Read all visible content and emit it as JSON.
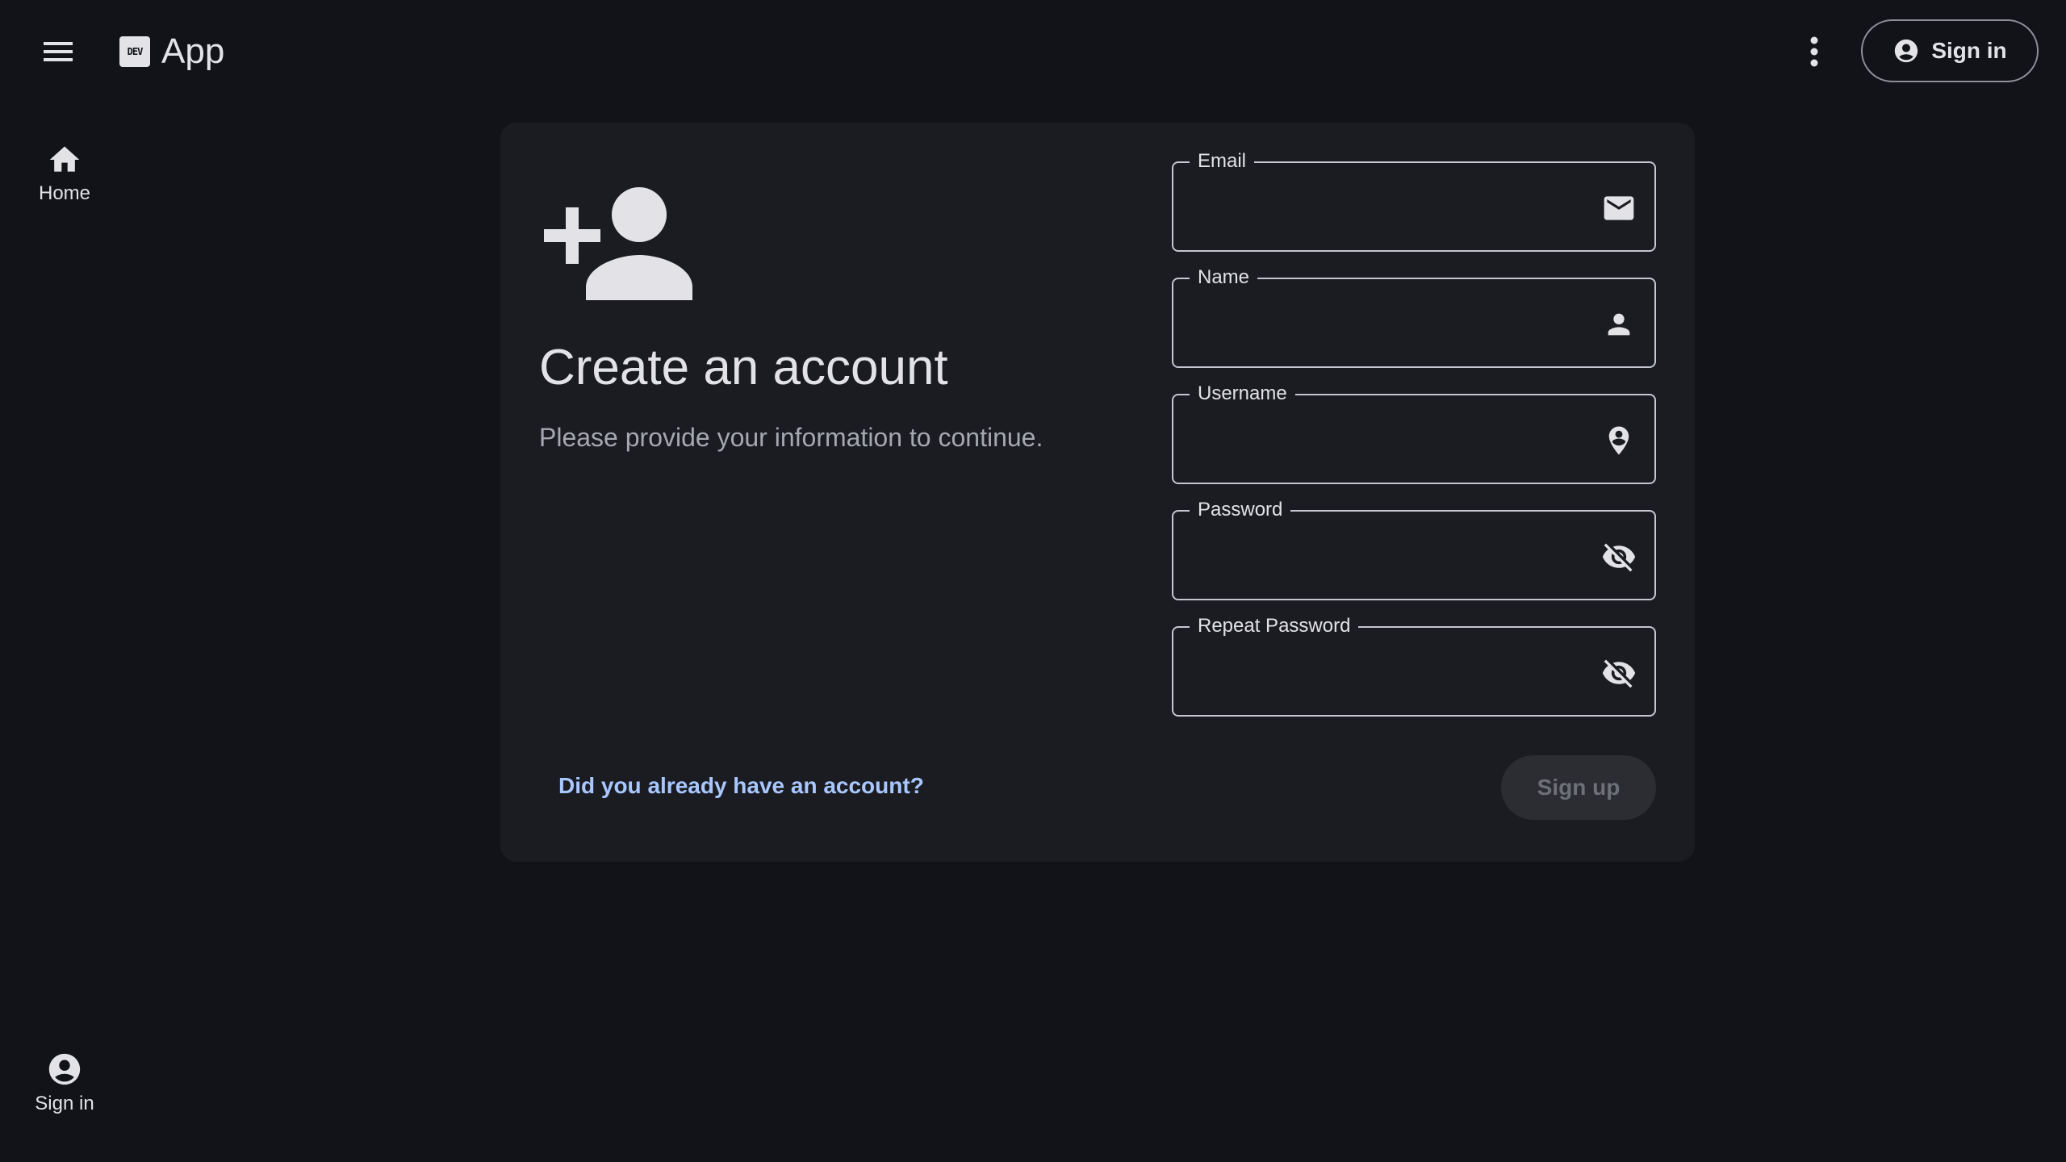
{
  "header": {
    "app_title": "App",
    "logo_text": "DEV",
    "signin_label": "Sign in"
  },
  "rail": {
    "home_label": "Home",
    "signin_label": "Sign in"
  },
  "form": {
    "title": "Create an account",
    "subtitle": "Please provide your information to continue.",
    "fields": [
      {
        "label": "Email",
        "value": "",
        "icon": "mail-icon"
      },
      {
        "label": "Name",
        "value": "",
        "icon": "person-icon"
      },
      {
        "label": "Username",
        "value": "",
        "icon": "person-pin-icon"
      },
      {
        "label": "Password",
        "value": "",
        "icon": "visibility-off-icon"
      },
      {
        "label": "Repeat Password",
        "value": "",
        "icon": "visibility-off-icon"
      }
    ],
    "login_link": "Did you already have an account?",
    "submit_label": "Sign up"
  },
  "colors": {
    "background": "#111318",
    "card": "#1b1c21",
    "link": "#a9c7ff",
    "text": "#e3e2e6",
    "muted": "#a6a8b1"
  }
}
